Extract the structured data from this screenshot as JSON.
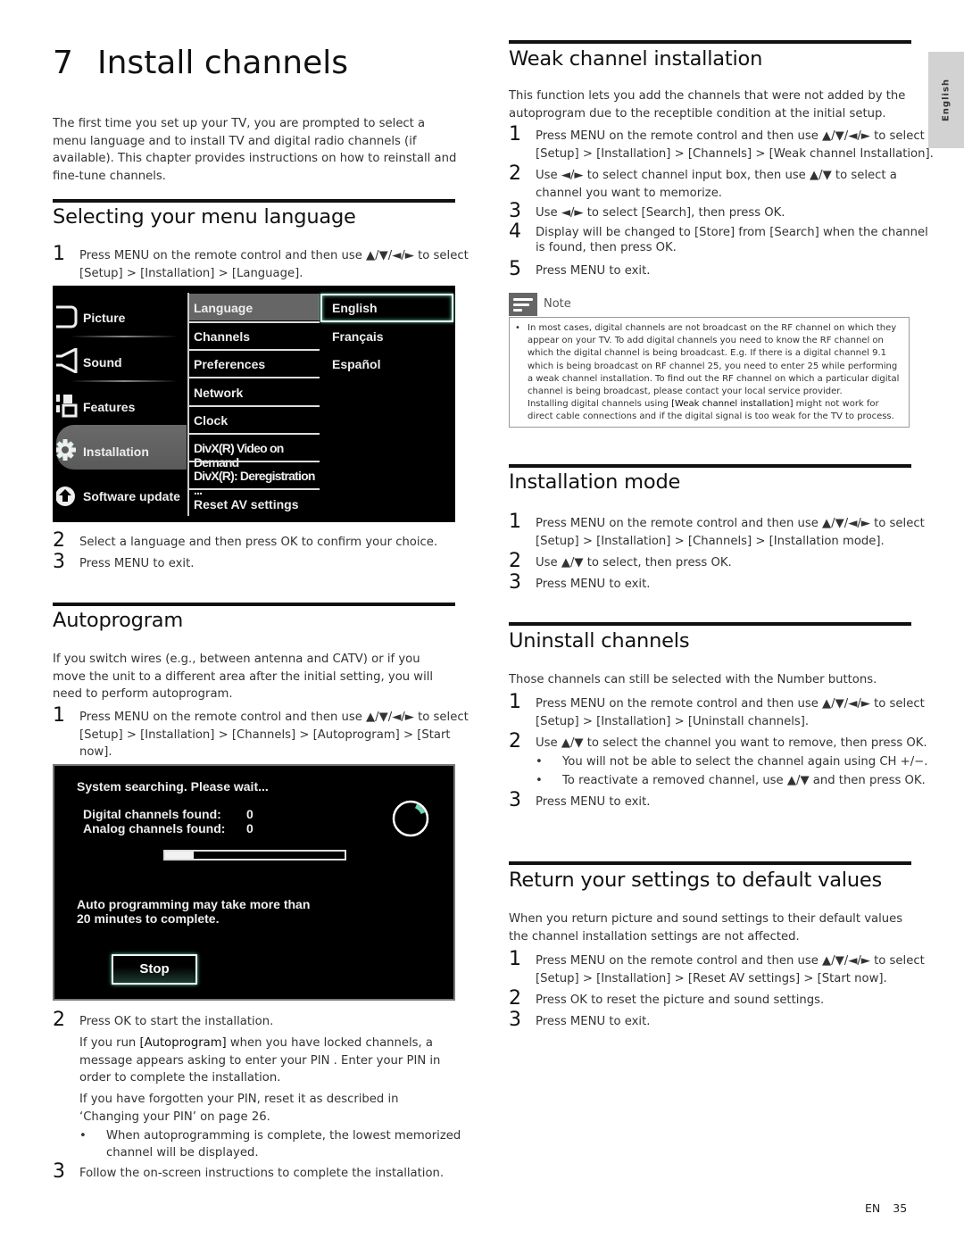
{
  "side_tab": "English",
  "chapter": {
    "number": "7",
    "title": "Install channels",
    "intro": "The first time you set up your TV, you are prompted to select a menu language and to install TV and digital radio channels (if available). This chapter provides instructions on how to reinstall and fine-tune channels."
  },
  "menu_language": {
    "title": "Selecting your menu language",
    "steps": [
      {
        "n": "1",
        "text": "Press MENU on the remote control and then use ▲/▼/◄/► to select [Setup] > [Installation] > [Language]."
      },
      {
        "n": "2",
        "text": "Select a language and then press OK to confirm your choice."
      },
      {
        "n": "3",
        "text": "Press MENU to exit."
      }
    ],
    "tv_menu": {
      "main_items": [
        {
          "label": "Picture",
          "icon": "picture-icon"
        },
        {
          "label": "Sound",
          "icon": "speaker-icon"
        },
        {
          "label": "Features",
          "icon": "features-icon"
        },
        {
          "label": "Installation",
          "icon": "gear-icon",
          "selected": true
        },
        {
          "label": "Software update",
          "icon": "upload-icon"
        }
      ],
      "sub_items": [
        "Language",
        "Channels",
        "Preferences",
        "Network",
        "Clock",
        "DivX(R) Video on Demand",
        "DivX(R): Deregistration ...",
        "Reset AV settings"
      ],
      "sub_selected": "Language",
      "options": [
        "English",
        "Français",
        "Español"
      ],
      "option_selected": "English",
      "accent": "#6fd6b0"
    }
  },
  "autoprogram": {
    "title": "Autoprogram",
    "intro": "If you switch wires (e.g., between antenna and CATV) or if you move the unit to a different area after the initial setting, you will need to perform autoprogram.",
    "step1": {
      "n": "1",
      "text": "Press MENU on the remote control and then use ▲/▼/◄/► to select [Setup] > [Installation] > [Channels] > [Autoprogram] > [Start now]."
    },
    "dialog": {
      "status": "System searching. Please wait...",
      "digital_label": "Digital channels found:",
      "digital_value": "0",
      "analog_label": "Analog channels found:",
      "analog_value": "0",
      "progress_percent": 16,
      "message_line1": "Auto programming may take more than",
      "message_line2": "20 minutes to complete.",
      "stop_label": "Stop"
    },
    "step2": {
      "n": "2",
      "text": "Press OK to start the installation."
    },
    "para1_pre": "If you run ",
    "para1_kw": "[Autoprogram]",
    "para1_post": " when you have locked channels, a message appears asking to enter your PIN . Enter your PIN in order to complete the installation.",
    "para2": "If you have forgotten your PIN, reset it as described in ‘Changing your PIN’ on page 26.",
    "bullet": "When autoprogramming is complete, the lowest memorized channel will be displayed.",
    "step3": {
      "n": "3",
      "text": "Follow the on-screen instructions to complete the installation."
    }
  },
  "weak_channel": {
    "title": "Weak channel installation",
    "intro": "This function lets you add the channels that were not added by the autoprogram due to the receptible condition at the initial setup.",
    "steps": [
      {
        "n": "1",
        "text": "Press MENU on the remote control and then use ▲/▼/◄/► to select [Setup] > [Installation] > [Channels] > [Weak channel Installation]."
      },
      {
        "n": "2",
        "text": "Use ◄/► to select channel input box, then use ▲/▼ to select a channel you want to memorize."
      },
      {
        "n": "3",
        "text": "Use ◄/► to select [Search], then press OK."
      },
      {
        "n": "4",
        "text": "Display will be changed to [Store] from [Search] when the channel is found, then press OK."
      },
      {
        "n": "5",
        "text": "Press MENU to exit."
      }
    ],
    "note_label": "Note",
    "note_text1": "In most cases, digital channels are not broadcast on the RF channel on which they appear on your TV. To add digital channels you need to know the RF channel on which the digital channel is being broadcast. E.g. If there is a digital channel 9.1 which is being broadcast on RF channel 25, you need to enter 25 while performing a weak channel installation. To find out the RF channel on which a particular digital channel is being broadcast, please contact your local service provider.",
    "note_text2_pre": "Installing digital channels using ",
    "note_text2_kw": "[Weak channel installation]",
    "note_text2_post": " might not work for direct cable connections and if the digital signal is too weak for the TV to process."
  },
  "installation_mode": {
    "title": "Installation mode",
    "steps": [
      {
        "n": "1",
        "text": "Press MENU on the remote control and then use ▲/▼/◄/► to select [Setup] > [Installation] > [Channels] > [Installation mode]."
      },
      {
        "n": "2",
        "text": "Use ▲/▼ to select, then press OK."
      },
      {
        "n": "3",
        "text": "Press MENU to exit."
      }
    ]
  },
  "uninstall": {
    "title": "Uninstall channels",
    "intro": "Those channels can still be selected with the Number buttons.",
    "steps": [
      {
        "n": "1",
        "text": "Press MENU on the remote control and then use ▲/▼/◄/► to select [Setup] > [Installation] > [Uninstall channels]."
      },
      {
        "n": "2",
        "text": "Use ▲/▼ to select the channel you want to remove, then press OK."
      },
      {
        "n": "3",
        "text": "Press MENU to exit."
      }
    ],
    "bullets": [
      "You will not be able to select the channel again using CH +/−.",
      "To reactivate a removed channel, use ▲/▼ and then press OK."
    ]
  },
  "reset_defaults": {
    "title": "Return your settings to default values",
    "intro": "When you return picture and sound settings to their default values the channel installation settings are not affected.",
    "steps": [
      {
        "n": "1",
        "text": "Press MENU on the remote control and then use ▲/▼/◄/► to select [Setup] > [Installation] > [Reset AV settings] > [Start now]."
      },
      {
        "n": "2",
        "text": "Press OK to reset the picture and sound settings."
      },
      {
        "n": "3",
        "text": "Press MENU to exit."
      }
    ]
  },
  "footer": {
    "lang": "EN",
    "page": "35"
  }
}
